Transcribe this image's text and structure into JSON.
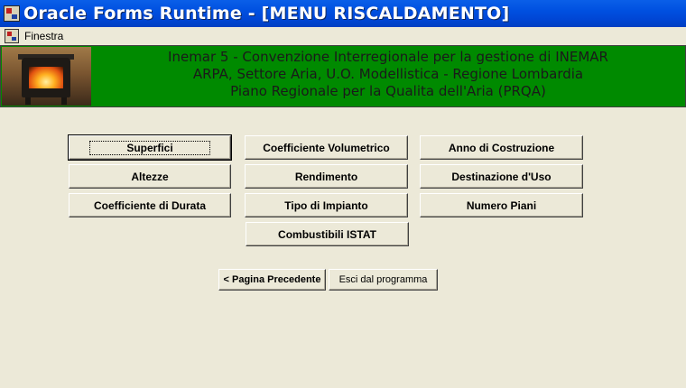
{
  "window": {
    "title": "Oracle Forms Runtime - [MENU RISCALDAMENTO]"
  },
  "menubar": {
    "items": [
      "Finestra"
    ]
  },
  "banner": {
    "line1": "Inemar 5 - Convenzione Interregionale per la gestione di INEMAR",
    "line2": "ARPA, Settore Aria, U.O. Modellistica - Regione Lombardia",
    "line3": "Piano Regionale per la Qualita dell'Aria (PRQA)",
    "background_color": "#008a00"
  },
  "buttons": {
    "superfici": "Superfici",
    "coeff_volumetrico": "Coefficiente Volumetrico",
    "anno_costruzione": "Anno di Costruzione",
    "altezze": "Altezze",
    "rendimento": "Rendimento",
    "destinazione_uso": "Destinazione d'Uso",
    "coeff_durata": "Coefficiente di Durata",
    "tipo_impianto": "Tipo di Impianto",
    "numero_piani": "Numero Piani",
    "combustibili_istat": "Combustibili ISTAT",
    "pagina_precedente": "< Pagina Precedente",
    "esci": "Esci dal programma"
  }
}
